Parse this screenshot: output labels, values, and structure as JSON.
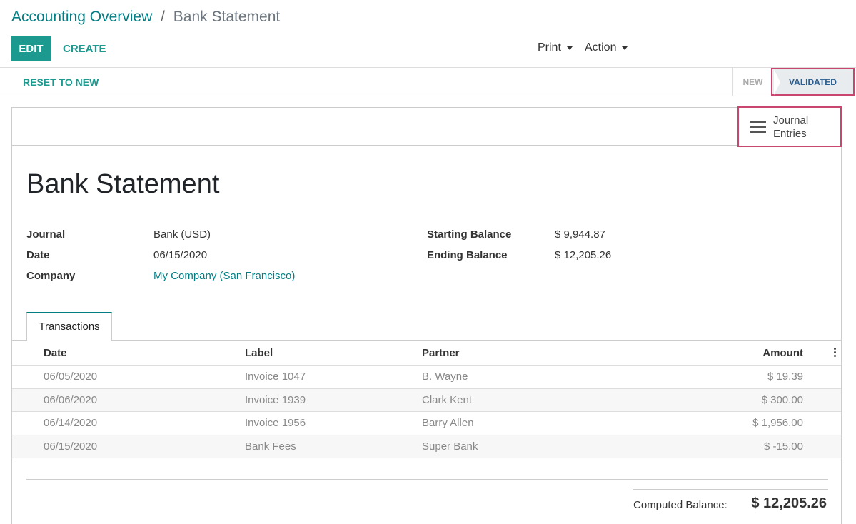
{
  "breadcrumb": {
    "parent": "Accounting Overview",
    "separator": "/",
    "current": "Bank Statement"
  },
  "toolbar": {
    "edit_label": "EDIT",
    "create_label": "CREATE",
    "print_label": "Print",
    "action_label": "Action"
  },
  "statusbar": {
    "reset_label": "RESET TO NEW",
    "stages": [
      "NEW",
      "VALIDATED"
    ],
    "active_stage": "VALIDATED"
  },
  "smart_button": {
    "line1": "Journal",
    "line2": "Entries"
  },
  "form": {
    "title": "Bank Statement",
    "fields": {
      "journal_label": "Journal",
      "journal_value": "Bank (USD)",
      "date_label": "Date",
      "date_value": "06/15/2020",
      "company_label": "Company",
      "company_value": "My Company (San Francisco)",
      "starting_balance_label": "Starting Balance",
      "starting_balance_value": "$ 9,944.87",
      "ending_balance_label": "Ending Balance",
      "ending_balance_value": "$ 12,205.26"
    }
  },
  "tabs": {
    "transactions": "Transactions"
  },
  "table": {
    "headers": {
      "date": "Date",
      "label": "Label",
      "partner": "Partner",
      "amount": "Amount"
    },
    "rows": [
      {
        "date": "06/05/2020",
        "label": "Invoice 1047",
        "partner": "B. Wayne",
        "amount": "$ 19.39"
      },
      {
        "date": "06/06/2020",
        "label": "Invoice 1939",
        "partner": "Clark Kent",
        "amount": "$ 300.00"
      },
      {
        "date": "06/14/2020",
        "label": "Invoice 1956",
        "partner": "Barry Allen",
        "amount": "$ 1,956.00"
      },
      {
        "date": "06/15/2020",
        "label": "Bank Fees",
        "partner": "Super Bank",
        "amount": "$ -15.00"
      }
    ]
  },
  "totals": {
    "computed_label": "Computed Balance:",
    "computed_value": "$ 12,205.26"
  },
  "colors": {
    "brand": "#1d9a8f",
    "link": "#017e84",
    "highlight": "#c9466f"
  },
  "icons": {
    "journal": "hamburger-menu-icon",
    "caret": "caret-down-icon",
    "column_options": "vertical-dots-icon"
  }
}
